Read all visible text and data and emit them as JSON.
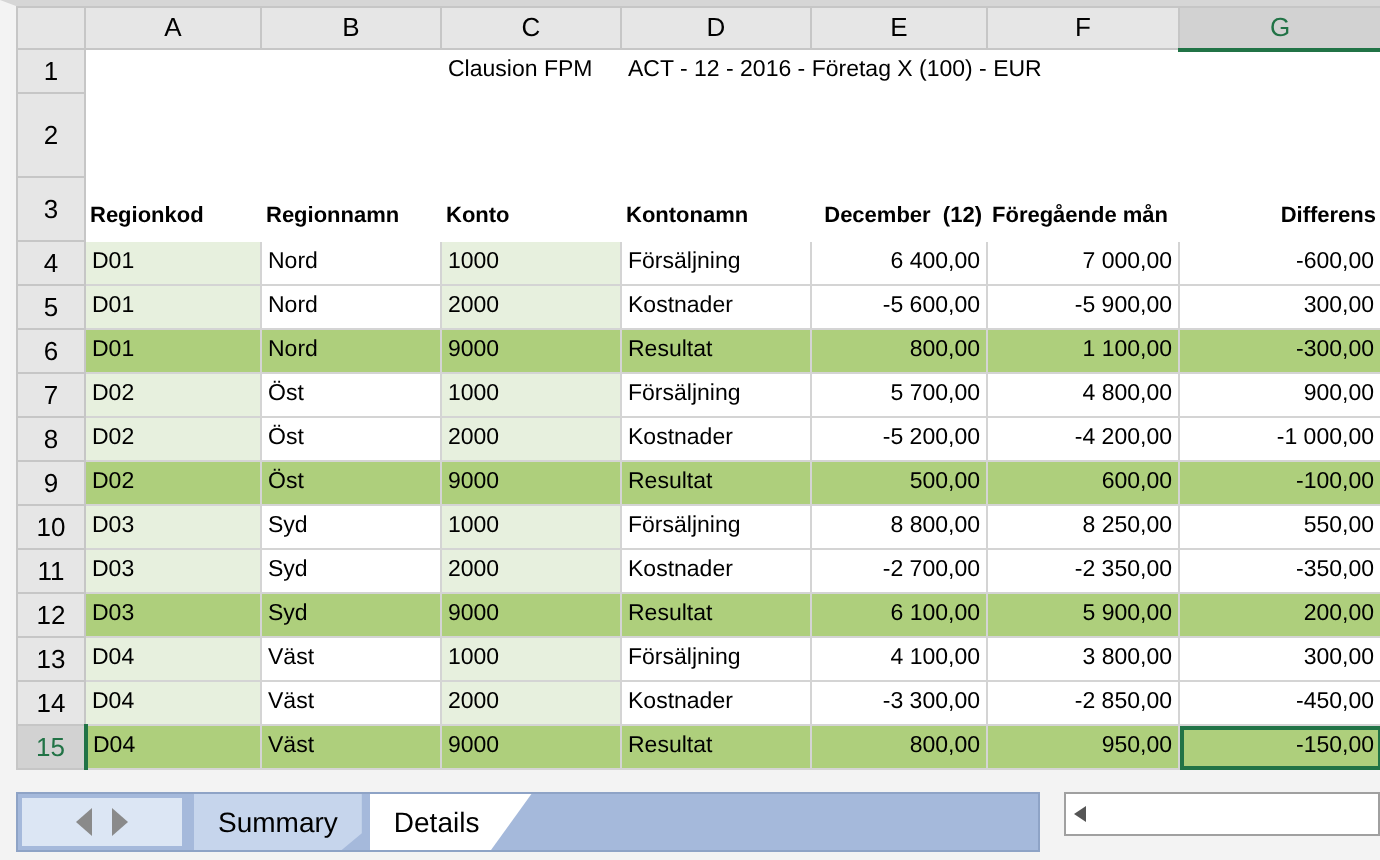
{
  "columns": [
    {
      "letter": "A",
      "selected": false
    },
    {
      "letter": "B",
      "selected": false
    },
    {
      "letter": "C",
      "selected": false
    },
    {
      "letter": "D",
      "selected": false
    },
    {
      "letter": "E",
      "selected": false
    },
    {
      "letter": "F",
      "selected": false
    },
    {
      "letter": "G",
      "selected": true
    }
  ],
  "title_row": {
    "number": "1",
    "app": "Clausion FPM",
    "context": "ACT - 12 - 2016 - Företag X (100) - EUR"
  },
  "blank_row": {
    "number": "2"
  },
  "header_row": {
    "number": "3",
    "cells": [
      "Regionkod",
      "Regionnamn",
      "Konto",
      "Kontonamn",
      "December  (12)",
      "Föregående mån",
      "Differens"
    ]
  },
  "rows": [
    {
      "number": "4",
      "kind": "detail",
      "cells": [
        "D01",
        "Nord",
        "1000",
        "Försäljning",
        "6 400,00",
        "7 000,00",
        "-600,00"
      ]
    },
    {
      "number": "5",
      "kind": "detail",
      "cells": [
        "D01",
        "Nord",
        "2000",
        "Kostnader",
        "-5 600,00",
        "-5 900,00",
        "300,00"
      ]
    },
    {
      "number": "6",
      "kind": "total",
      "cells": [
        "D01",
        "Nord",
        "9000",
        "Resultat",
        "800,00",
        "1 100,00",
        "-300,00"
      ]
    },
    {
      "number": "7",
      "kind": "detail",
      "cells": [
        "D02",
        "Öst",
        "1000",
        "Försäljning",
        "5 700,00",
        "4 800,00",
        "900,00"
      ]
    },
    {
      "number": "8",
      "kind": "detail",
      "cells": [
        "D02",
        "Öst",
        "2000",
        "Kostnader",
        "-5 200,00",
        "-4 200,00",
        "-1 000,00"
      ]
    },
    {
      "number": "9",
      "kind": "total",
      "cells": [
        "D02",
        "Öst",
        "9000",
        "Resultat",
        "500,00",
        "600,00",
        "-100,00"
      ]
    },
    {
      "number": "10",
      "kind": "detail",
      "cells": [
        "D03",
        "Syd",
        "1000",
        "Försäljning",
        "8 800,00",
        "8 250,00",
        "550,00"
      ]
    },
    {
      "number": "11",
      "kind": "detail",
      "cells": [
        "D03",
        "Syd",
        "2000",
        "Kostnader",
        "-2 700,00",
        "-2 350,00",
        "-350,00"
      ]
    },
    {
      "number": "12",
      "kind": "total",
      "cells": [
        "D03",
        "Syd",
        "9000",
        "Resultat",
        "6 100,00",
        "5 900,00",
        "200,00"
      ]
    },
    {
      "number": "13",
      "kind": "detail",
      "cells": [
        "D04",
        "Väst",
        "1000",
        "Försäljning",
        "4 100,00",
        "3 800,00",
        "300,00"
      ]
    },
    {
      "number": "14",
      "kind": "detail",
      "cells": [
        "D04",
        "Väst",
        "2000",
        "Kostnader",
        "-3 300,00",
        "-2 850,00",
        "-450,00"
      ]
    },
    {
      "number": "15",
      "kind": "total",
      "selected": true,
      "cells": [
        "D04",
        "Väst",
        "9000",
        "Resultat",
        "800,00",
        "950,00",
        "-150,00"
      ]
    }
  ],
  "sheet_tabs": [
    {
      "label": "Summary",
      "selected": false
    },
    {
      "label": "Details",
      "selected": true
    }
  ]
}
